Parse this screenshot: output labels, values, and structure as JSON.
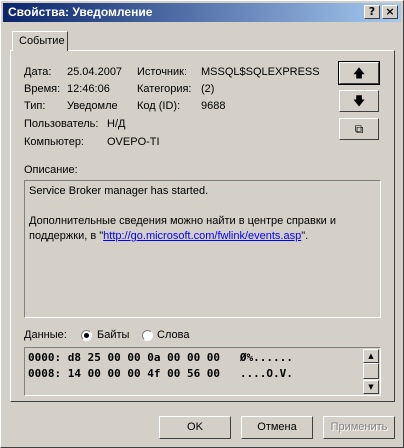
{
  "window": {
    "title": "Свойства: Уведомление",
    "help_button": "?",
    "close_button": "×"
  },
  "tabs": [
    {
      "label": "Событие"
    }
  ],
  "event": {
    "date_label": "Дата:",
    "date": "25.04.2007",
    "time_label": "Время:",
    "time": "12:46:06",
    "type_label": "Тип:",
    "type": "Уведомле",
    "user_label": "Пользователь:",
    "user": "Н/Д",
    "computer_label": "Компьютер:",
    "computer": "OVEPO-TI",
    "source_label": "Источник:",
    "source": "MSSQL$SQLEXPRESS",
    "category_label": "Категория:",
    "category": "(2)",
    "id_label": "Код (ID):",
    "id": "9688"
  },
  "nav_buttons": {
    "up": "🡅",
    "down": "🡇",
    "copy": "⧉"
  },
  "description": {
    "label": "Описание:",
    "line1": "Service Broker manager has started.",
    "line2": "Дополнительные сведения можно найти в центре справки и",
    "line3_prefix": "поддержки, в \"",
    "link": "http://go.microsoft.com/fwlink/events.asp",
    "line3_suffix": "\"."
  },
  "data_section": {
    "label": "Данные:",
    "option_bytes": "Байты",
    "option_words": "Слова",
    "selected": "Байты",
    "rows": [
      "0000: d8 25 00 00 0a 00 00 00   Ø%......",
      "0008: 14 00 00 00 4f 00 56 00   ....O.V."
    ]
  },
  "buttons": {
    "ok": "OK",
    "cancel": "Отмена",
    "apply": "Применить"
  },
  "colors": {
    "titlebar_start": "#0a246a",
    "titlebar_end": "#a6caf0",
    "face": "#d4d0c8",
    "link": "#0000ff"
  }
}
